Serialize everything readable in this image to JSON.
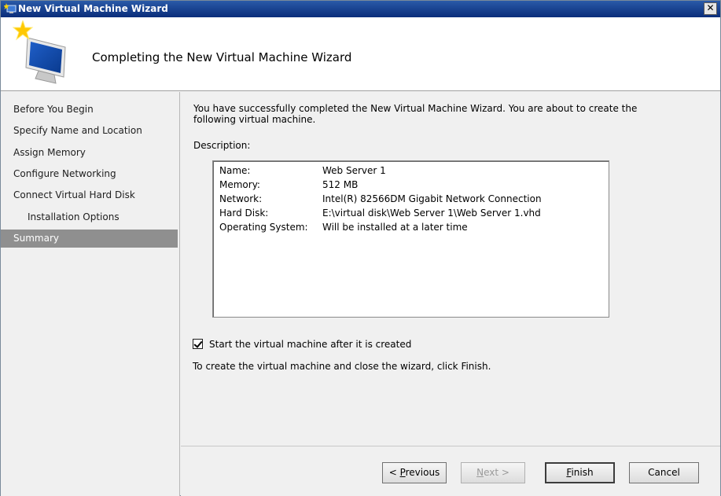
{
  "window": {
    "title": "New Virtual Machine Wizard",
    "close_label": "✕"
  },
  "header": {
    "heading": "Completing the New Virtual Machine Wizard"
  },
  "nav": {
    "items": [
      {
        "label": "Before You Begin"
      },
      {
        "label": "Specify Name and Location"
      },
      {
        "label": "Assign Memory"
      },
      {
        "label": "Configure Networking"
      },
      {
        "label": "Connect Virtual Hard Disk"
      },
      {
        "label": "Installation Options"
      },
      {
        "label": "Summary"
      }
    ]
  },
  "content": {
    "intro": "You have successfully completed the New Virtual Machine Wizard. You are about to create the following virtual machine.",
    "description_label": "Description:",
    "summary": [
      {
        "key": "Name:",
        "value": "Web Server 1"
      },
      {
        "key": "Memory:",
        "value": "512 MB"
      },
      {
        "key": "Network:",
        "value": "Intel(R) 82566DM Gigabit Network Connection"
      },
      {
        "key": "Hard Disk:",
        "value": "E:\\virtual disk\\Web Server 1\\Web Server 1.vhd"
      },
      {
        "key": "Operating System:",
        "value": "Will be installed at a later time"
      }
    ],
    "start_checkbox_label": "Start the virtual machine after it is created",
    "start_checkbox_checked": true,
    "finish_note": "To create the virtual machine and close the wizard, click Finish."
  },
  "footer": {
    "previous_prefix": "< ",
    "previous_access": "P",
    "previous_rest": "revious",
    "next_access": "N",
    "next_rest": "ext >",
    "finish_access": "F",
    "finish_rest": "inish",
    "cancel_label": "Cancel"
  }
}
